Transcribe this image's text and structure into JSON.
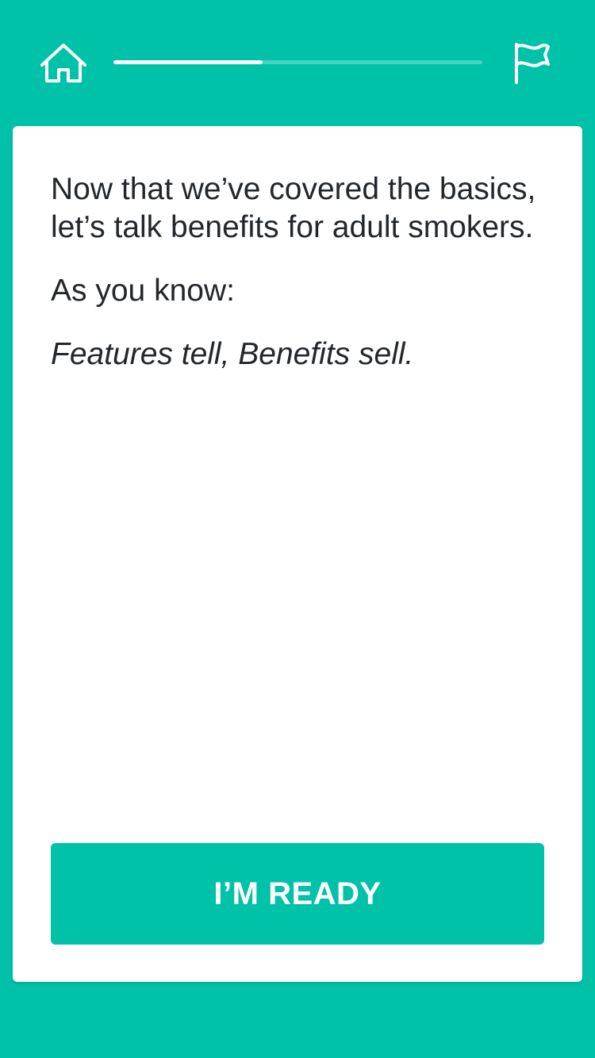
{
  "header": {
    "home_icon": "home-icon",
    "flag_icon": "flag-icon",
    "progress": 0.405
  },
  "content": {
    "intro": "Now that we’ve covered the basics, let’s talk benefits for adult smokers.",
    "lead_in": "As you know:",
    "quote": "Features tell, Benefits sell."
  },
  "actions": {
    "ready_label": "I’M READY"
  },
  "colors": {
    "accent": "#00c2a8",
    "card": "#ffffff",
    "text": "#23272b"
  }
}
